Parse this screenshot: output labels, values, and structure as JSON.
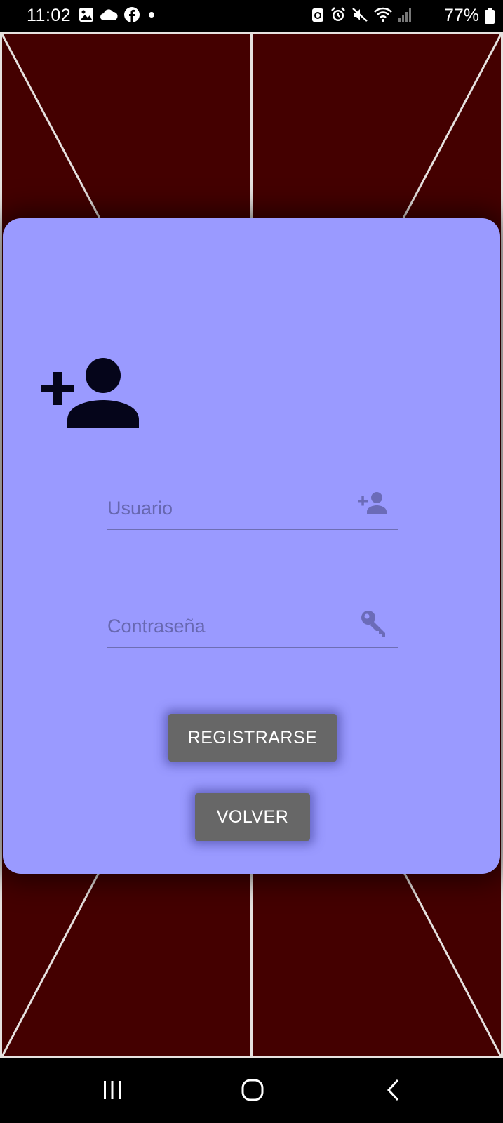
{
  "status_bar": {
    "time": "11:02",
    "battery": "77%",
    "left_icons": [
      "gallery-icon",
      "cloud-icon",
      "facebook-icon",
      "dot-icon"
    ],
    "right_icons": [
      "recycle-icon",
      "alarm-icon",
      "mute-icon",
      "wifi-icon",
      "signal-icon",
      "battery-icon"
    ]
  },
  "colors": {
    "background_panel": "#440000",
    "card": "#9a9aff",
    "button": "#676767",
    "accent_dark": "#05051a"
  },
  "register_form": {
    "header_icon": "person-add-icon",
    "username": {
      "value": "",
      "placeholder": "Usuario",
      "icon": "person-add-icon"
    },
    "password": {
      "value": "",
      "placeholder": "Contraseña",
      "icon": "key-icon"
    },
    "register_button": "REGISTRARSE",
    "back_button": "VOLVER"
  },
  "nav_bar": {
    "buttons": [
      "recents-icon",
      "home-icon",
      "back-icon"
    ]
  }
}
